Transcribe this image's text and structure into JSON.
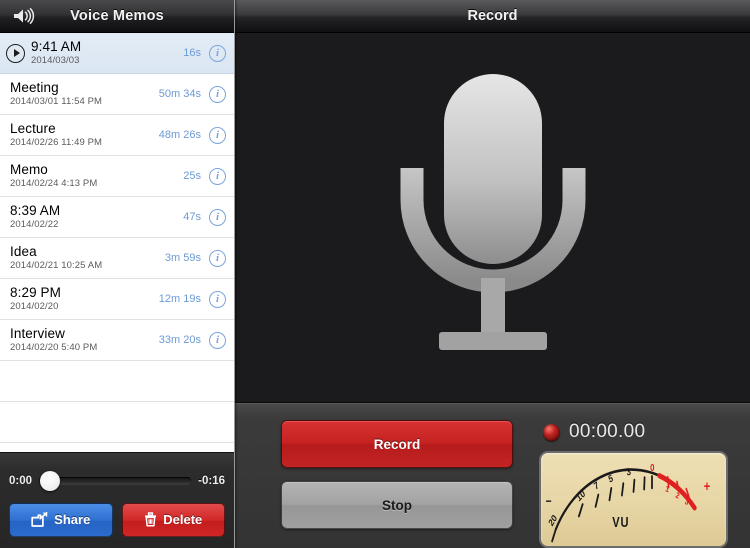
{
  "left": {
    "header": {
      "title": "Voice Memos",
      "speaker_icon": "speaker-waves-icon"
    },
    "memos": [
      {
        "title": "9:41 AM",
        "date": "2014/03/03",
        "duration": "16s",
        "selected": true,
        "play_icon": "play-circle-icon",
        "info_label": "i"
      },
      {
        "title": "Meeting",
        "date": "2014/03/01 11:54 PM",
        "duration": "50m 34s",
        "selected": false,
        "info_label": "i"
      },
      {
        "title": "Lecture",
        "date": "2014/02/26 11:49 PM",
        "duration": "48m 26s",
        "selected": false,
        "info_label": "i"
      },
      {
        "title": "Memo",
        "date": "2014/02/24 4:13 PM",
        "duration": "25s",
        "selected": false,
        "info_label": "i"
      },
      {
        "title": "8:39 AM",
        "date": "2014/02/22",
        "duration": "47s",
        "selected": false,
        "info_label": "i"
      },
      {
        "title": "Idea",
        "date": "2014/02/21 10:25 AM",
        "duration": "3m 59s",
        "selected": false,
        "info_label": "i"
      },
      {
        "title": "8:29 PM",
        "date": "2014/02/20",
        "duration": "12m 19s",
        "selected": false,
        "info_label": "i"
      },
      {
        "title": "Interview",
        "date": "2014/02/20 5:40 PM",
        "duration": "33m 20s",
        "selected": false,
        "info_label": "i"
      }
    ],
    "player": {
      "elapsed": "0:00",
      "remaining": "-0:16",
      "progress_percent": 0
    },
    "actions": {
      "share_label": "Share",
      "share_icon": "share-arrow-icon",
      "delete_label": "Delete",
      "delete_icon": "trash-icon"
    }
  },
  "right": {
    "header": {
      "title": "Record"
    },
    "stage": {
      "icon": "microphone-icon"
    },
    "controls": {
      "record_label": "Record",
      "stop_label": "Stop"
    },
    "meter": {
      "led_icon": "record-led-icon",
      "timer": "00:00.00",
      "vu_label": "VU",
      "minus_sign": "−",
      "plus_sign": "+",
      "scale_labels": [
        "20",
        "10",
        "7",
        "5",
        "3",
        "0",
        "1",
        "2",
        "3"
      ],
      "red_zone_start": "0"
    }
  },
  "colors": {
    "accent_blue": "#7ba4da",
    "record_red": "#c62222",
    "share_blue": "#2f6fd0",
    "delete_red": "#d12626",
    "vu_face": "#e7d6a6",
    "vu_red": "#e02020",
    "selected_row": "#dbe6f3"
  }
}
